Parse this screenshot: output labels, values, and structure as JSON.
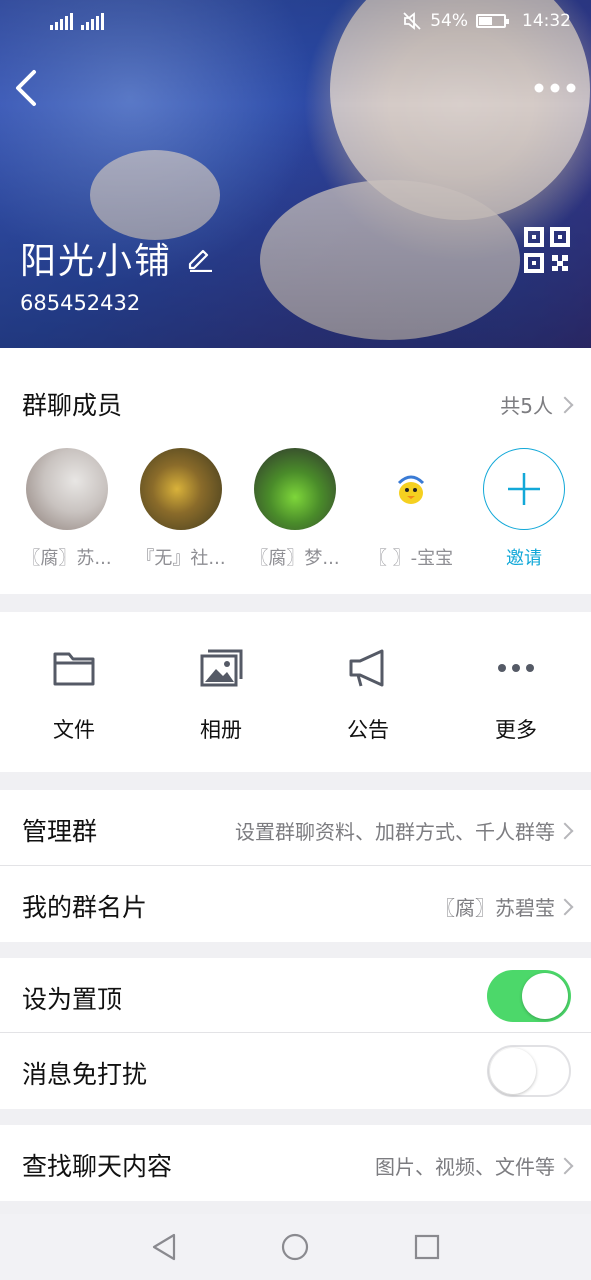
{
  "status_bar": {
    "signal_1": "4G",
    "signal_2": "4G",
    "battery": "54%",
    "time": "14:32"
  },
  "header": {
    "group_name": "阳光小铺",
    "group_id": "685452432"
  },
  "members": {
    "title": "群聊成员",
    "count": "共5人",
    "list": [
      {
        "name": "〖腐〗苏..."
      },
      {
        "name": "『无』社..."
      },
      {
        "name": "〖腐〗梦..."
      },
      {
        "name": "〖 〗-宝宝"
      }
    ],
    "invite_label": "邀请"
  },
  "tools": [
    {
      "label": "文件",
      "icon": "folder-icon"
    },
    {
      "label": "相册",
      "icon": "photo-album-icon"
    },
    {
      "label": "公告",
      "icon": "megaphone-icon"
    },
    {
      "label": "更多",
      "icon": "more-dots-icon"
    }
  ],
  "rows": {
    "manage": {
      "label": "管理群",
      "value": "设置群聊资料、加群方式、千人群等"
    },
    "card": {
      "label": "我的群名片",
      "value": "〖腐〗苏碧莹"
    },
    "pin": {
      "label": "设为置顶",
      "on": true
    },
    "mute": {
      "label": "消息免打扰",
      "on": false
    },
    "search": {
      "label": "查找聊天内容",
      "value": "图片、视频、文件等"
    }
  },
  "colors": {
    "accent": "#12a8d8",
    "toggle_on": "#4cd86a"
  }
}
